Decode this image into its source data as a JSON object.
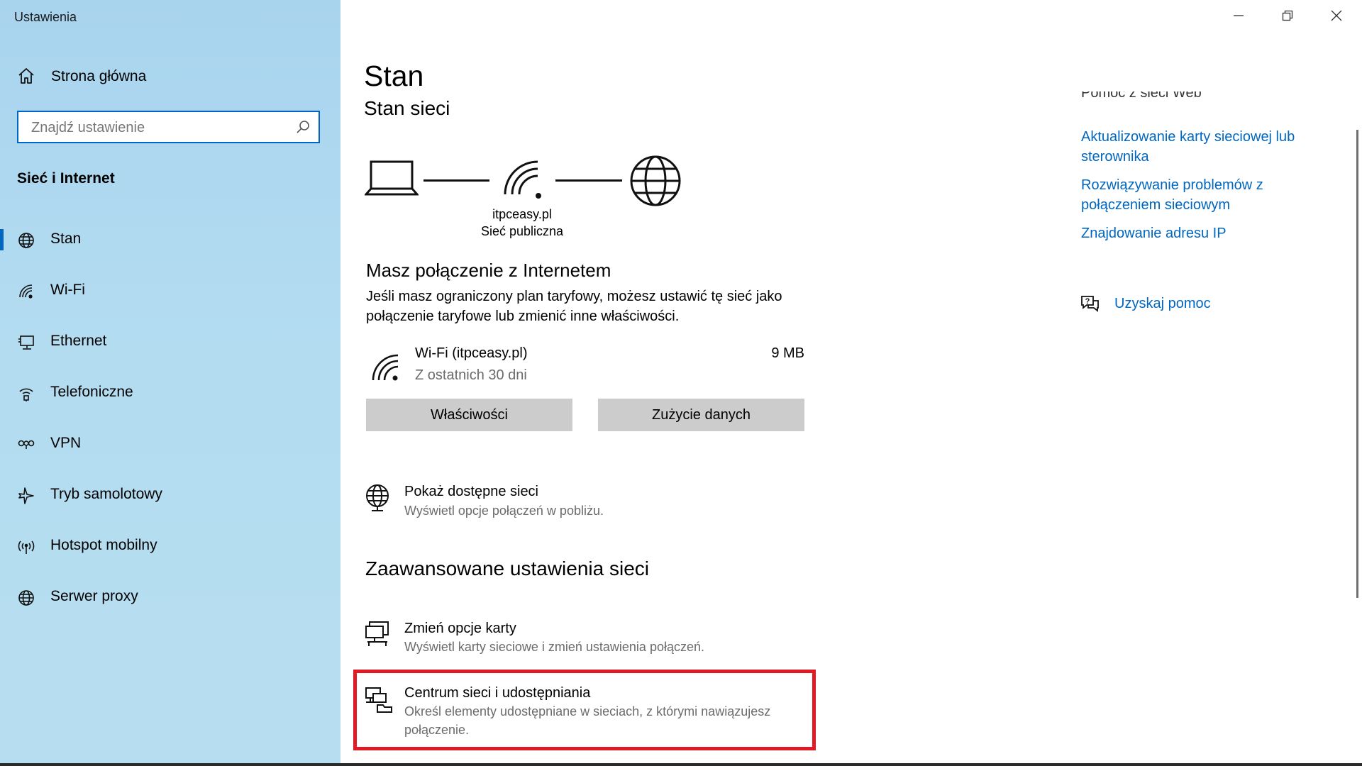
{
  "window": {
    "title": "Ustawienia"
  },
  "sidebar": {
    "home_label": "Strona główna",
    "search_placeholder": "Znajdź ustawienie",
    "section_title": "Sieć i Internet",
    "items": [
      {
        "label": "Stan",
        "icon": "globe-icon",
        "active": true
      },
      {
        "label": "Wi-Fi",
        "icon": "wifi-icon"
      },
      {
        "label": "Ethernet",
        "icon": "ethernet-icon"
      },
      {
        "label": "Telefoniczne",
        "icon": "dialup-icon"
      },
      {
        "label": "VPN",
        "icon": "vpn-icon"
      },
      {
        "label": "Tryb samolotowy",
        "icon": "airplane-icon"
      },
      {
        "label": "Hotspot mobilny",
        "icon": "hotspot-icon"
      },
      {
        "label": "Serwer proxy",
        "icon": "proxy-globe-icon"
      }
    ]
  },
  "main": {
    "title": "Stan",
    "subtitle": "Stan sieci",
    "diagram": {
      "network_name": "itpceasy.pl",
      "network_type": "Sieć publiczna"
    },
    "connected_heading": "Masz połączenie z Internetem",
    "connected_text": "Jeśli masz ograniczony plan taryfowy, możesz ustawić tę sieć jako połączenie taryfowe lub zmienić inne właściwości.",
    "connection": {
      "name": "Wi-Fi (itpceasy.pl)",
      "period": "Z ostatnich 30 dni",
      "usage": "9 MB"
    },
    "buttons": {
      "properties": "Właściwości",
      "data_usage": "Zużycie danych"
    },
    "show_networks": {
      "title": "Pokaż dostępne sieci",
      "subtitle": "Wyświetl opcje połączeń w pobliżu."
    },
    "advanced_heading": "Zaawansowane ustawienia sieci",
    "advanced_items": [
      {
        "title": "Zmień opcje karty",
        "subtitle": "Wyświetl karty sieciowe i zmień ustawienia połączeń."
      },
      {
        "title": "Centrum sieci i udostępniania",
        "subtitle": "Określ elementy udostępniane w sieciach, z którymi nawiązujesz połączenie."
      }
    ]
  },
  "help": {
    "heading": "Pomoc z sieci Web",
    "links": [
      "Aktualizowanie karty sieciowej lub sterownika",
      "Rozwiązywanie problemów z połączeniem sieciowym",
      "Znajdowanie adresu IP"
    ],
    "get_help": "Uzyskaj pomoc"
  },
  "colors": {
    "accent": "#0067c0",
    "highlight": "#e11b25",
    "sidebar": "#b3dcf1"
  }
}
